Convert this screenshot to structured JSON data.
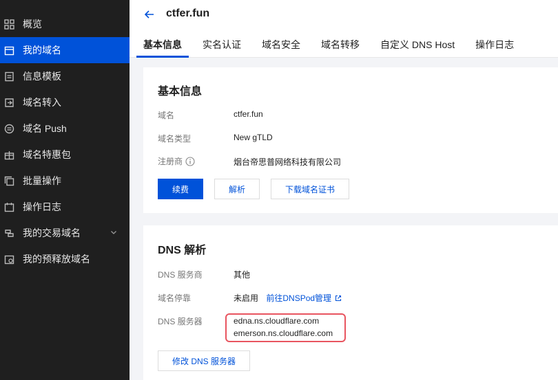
{
  "sidebar": {
    "items": [
      {
        "label": "概览",
        "icon": "grid-icon"
      },
      {
        "label": "我的域名",
        "icon": "calendar-icon",
        "active": true
      },
      {
        "label": "信息模板",
        "icon": "template-icon"
      },
      {
        "label": "域名转入",
        "icon": "transfer-in-icon"
      },
      {
        "label": "域名 Push",
        "icon": "push-icon"
      },
      {
        "label": "域名特惠包",
        "icon": "gift-icon"
      },
      {
        "label": "批量操作",
        "icon": "batch-icon"
      },
      {
        "label": "操作日志",
        "icon": "log-icon"
      },
      {
        "label": "我的交易域名",
        "icon": "trade-icon"
      },
      {
        "label": "我的预释放域名",
        "icon": "prerelease-icon"
      }
    ]
  },
  "header": {
    "title": "ctfer.fun",
    "tabs": [
      "基本信息",
      "实名认证",
      "域名安全",
      "域名转移",
      "自定义 DNS Host",
      "操作日志"
    ]
  },
  "basic_info": {
    "title": "基本信息",
    "rows": [
      {
        "label": "域名",
        "value": "ctfer.fun"
      },
      {
        "label": "域名类型",
        "value": "New gTLD"
      },
      {
        "label": "注册商",
        "value": "烟台帝思普网络科技有限公司"
      }
    ],
    "buttons": {
      "renew": "续费",
      "resolve": "解析",
      "download": "下载域名证书"
    }
  },
  "dns": {
    "title": "DNS 解析",
    "provider_label": "DNS 服务商",
    "provider_value": "其他",
    "parking_label": "域名停靠",
    "parking_value": "未启用",
    "parking_link": "前往DNSPod管理",
    "servers_label": "DNS 服务器",
    "servers": [
      "edna.ns.cloudflare.com",
      "emerson.ns.cloudflare.com"
    ],
    "modify_button": "修改 DNS 服务器"
  },
  "colors": {
    "accent": "#0052d9",
    "sidebar_bg": "#1f1f1f",
    "highlight": "#e8545f"
  }
}
